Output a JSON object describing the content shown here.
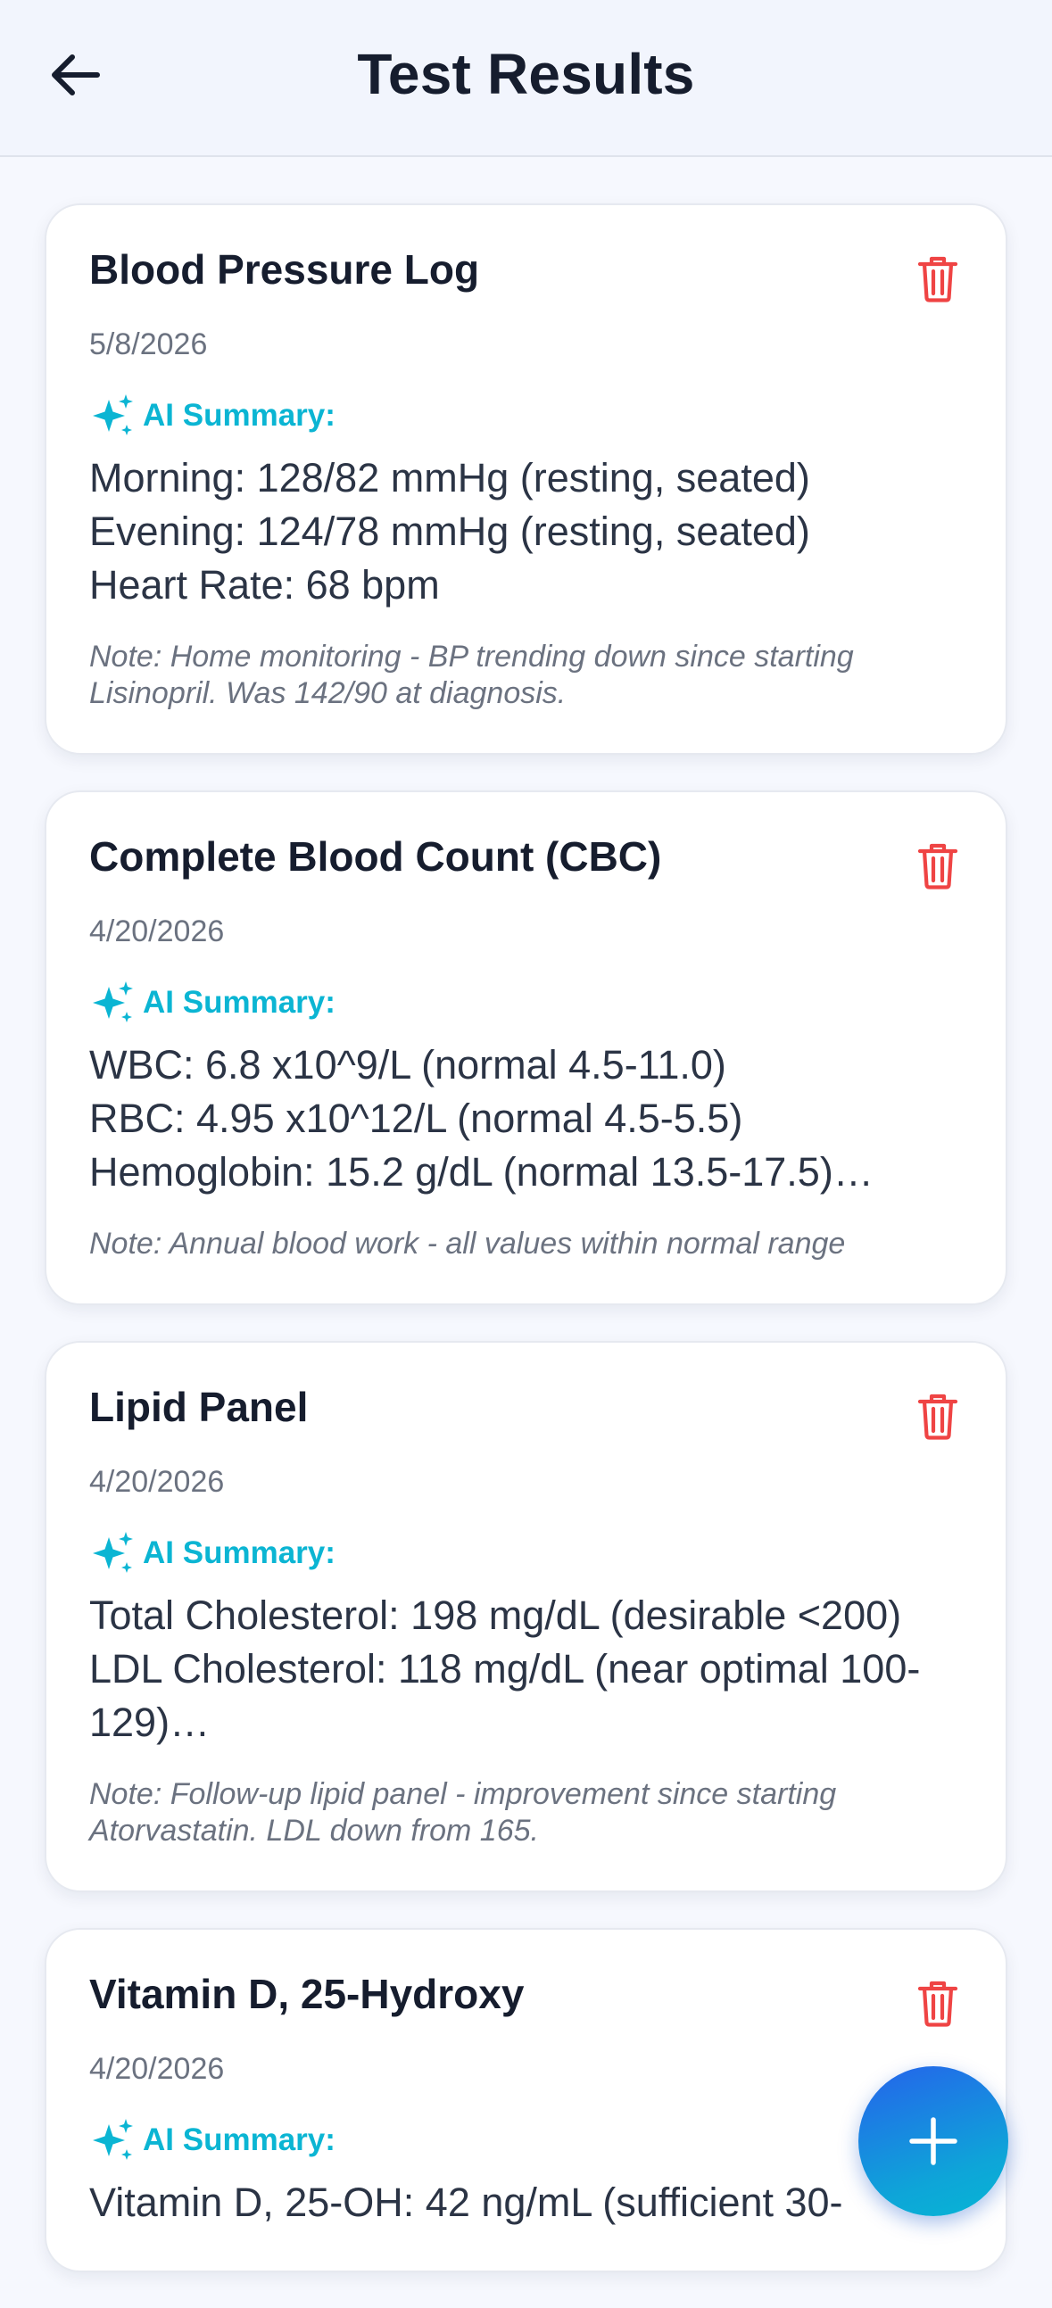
{
  "header": {
    "title": "Test Results",
    "back_icon": "arrow-left-icon"
  },
  "colors": {
    "accent": "#0bb5d3",
    "delete": "#ef4444",
    "fab_start": "#2563eb",
    "fab_end": "#06b6d4"
  },
  "ai_summary_label": "AI Summary:",
  "results": [
    {
      "title": "Blood Pressure Log",
      "date": "5/8/2026",
      "summary": "Morning: 128/82 mmHg (resting, seated)\nEvening: 124/78 mmHg (resting, seated)\nHeart Rate: 68 bpm",
      "note": "Note: Home monitoring - BP trending down since starting Lisinopril. Was 142/90 at diagnosis."
    },
    {
      "title": "Complete Blood Count (CBC)",
      "date": "4/20/2026",
      "summary": "WBC: 6.8 x10^9/L (normal 4.5-11.0)\nRBC: 4.95 x10^12/L (normal 4.5-5.5)\nHemoglobin: 15.2 g/dL (normal 13.5-17.5)…",
      "note": "Note: Annual blood work - all values within normal range"
    },
    {
      "title": "Lipid Panel",
      "date": "4/20/2026",
      "summary": "Total Cholesterol: 198 mg/dL (desirable <200)\nLDL Cholesterol: 118 mg/dL (near optimal 100-129)…",
      "note": "Note: Follow-up lipid panel - improvement since starting Atorvastatin. LDL down from 165."
    },
    {
      "title": "Vitamin D, 25-Hydroxy",
      "date": "4/20/2026",
      "summary": "Vitamin D, 25-OH: 42 ng/mL (sufficient 30-",
      "note": ""
    }
  ],
  "icons": {
    "delete": "trash-icon",
    "ai": "sparkles-icon",
    "fab": "plus-icon"
  }
}
